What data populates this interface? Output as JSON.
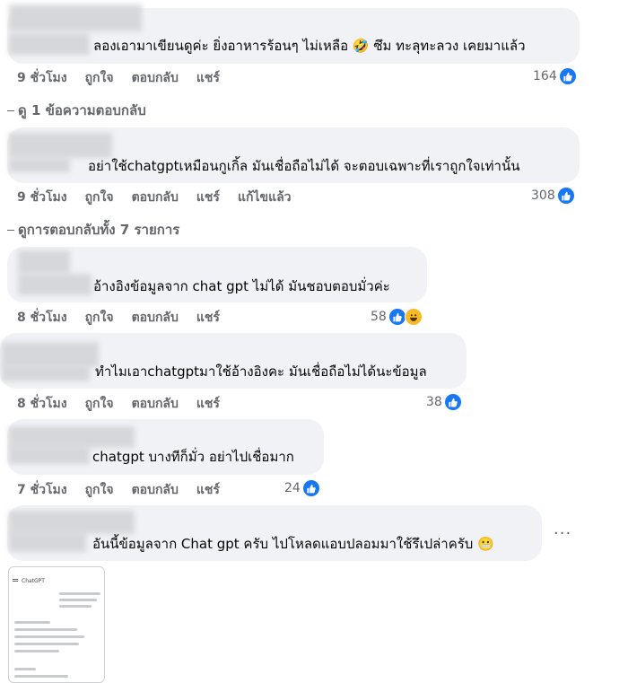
{
  "comments": [
    {
      "text": "ลองเอามาเขียนดูค่ะ ยิ่งอาหารร้อนๆ ไม่เหลือ 🤣 ซึม ทะลุทะลวง เคยมาแล้ว",
      "time": "9 ชั่วโมง",
      "like": "ถูกใจ",
      "reply": "ตอบกลับ",
      "share": "แชร์",
      "count": "164"
    },
    {
      "text": "อย่าใช้chatgptเหมือนกูเกิ้ล มันเชื่อถือไม่ได้ จะตอบเฉพาะที่เราถูกใจเท่านั้น",
      "time": "9 ชั่วโมง",
      "like": "ถูกใจ",
      "reply": "ตอบกลับ",
      "share": "แชร์",
      "edited": "แก้ไขแล้ว",
      "count": "308"
    },
    {
      "text": "อ้างอิงข้อมูลจาก chat gpt ไม่ได้ มันชอบตอบมั่วค่ะ",
      "time": "8 ชั่วโมง",
      "like": "ถูกใจ",
      "reply": "ตอบกลับ",
      "share": "แชร์",
      "count": "58"
    },
    {
      "text": "ทำไมเอาchatgptมาใช้อ้างอิงคะ มันเชื่อถือไม่ได้นะข้อมูล",
      "time": "8 ชั่วโมง",
      "like": "ถูกใจ",
      "reply": "ตอบกลับ",
      "share": "แชร์",
      "count": "38"
    },
    {
      "text": "chatgpt บางทีก็มั่ว อย่าไปเชื่อมาก",
      "time": "7 ชั่วโมง",
      "like": "ถูกใจ",
      "reply": "ตอบกลับ",
      "share": "แชร์",
      "count": "24"
    },
    {
      "text": "อันนี้ข้อมูลจาก Chat gpt ครับ ไปโหลดแอบปลอมมาใช้รึเปล่าครับ 😬"
    }
  ],
  "view_replies": [
    "ดู 1 ข้อความตอบกลับ",
    "ดูการตอบกลับทั้ง 7 รายการ"
  ],
  "more_button": "···",
  "attachment": {
    "app_title": "ChatGPT"
  },
  "colors": {
    "bubble": "#f0f2f5",
    "like": "#1877f2",
    "meta": "#65676b"
  }
}
